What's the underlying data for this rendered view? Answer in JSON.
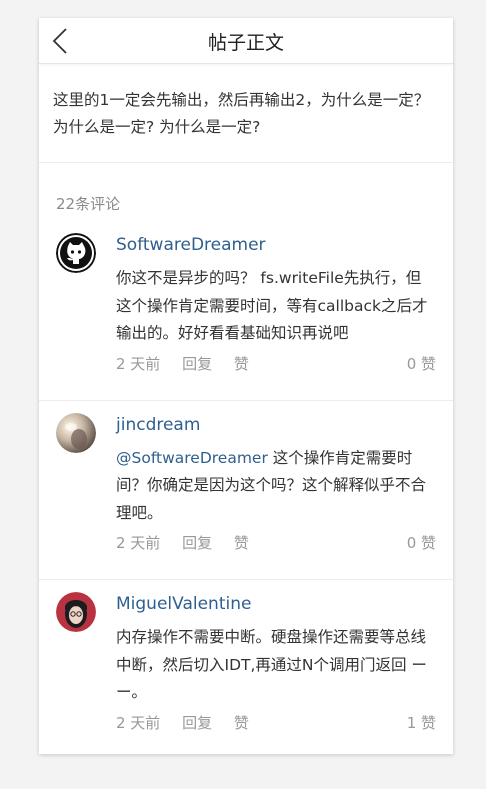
{
  "header": {
    "title": "帖子正文",
    "back_icon": "chevron-left-icon"
  },
  "post": {
    "content": "这里的1一定会先输出，然后再输出2，为什么是一定？ 为什么是一定? 为什么是一定?"
  },
  "comments_count": "22条评论",
  "comments": [
    {
      "author": "SoftwareDreamer",
      "avatar_icon": "github-octocat-icon",
      "mention": "",
      "text": "你这不是异步的吗？ fs.writeFile先执行，但这个操作肯定需要时间，等有callback之后才输出的。好好看看基础知识再说吧",
      "time": "2 天前",
      "reply": "回复",
      "like": "赞",
      "likes": "0 赞"
    },
    {
      "author": "jincdream",
      "avatar_icon": "user-photo-avatar",
      "mention": "@SoftwareDreamer",
      "text": " 这个操作肯定需要时间？你确定是因为这个吗？这个解释似乎不合理吧。",
      "time": "2 天前",
      "reply": "回复",
      "like": "赞",
      "likes": "0 赞"
    },
    {
      "author": "MiguelValentine",
      "avatar_icon": "user-photo-avatar",
      "mention": "",
      "text": "内存操作不需要中断。硬盘操作还需要等总线中断，然后切入IDT,再通过N个调用门返回 ー ー。",
      "time": "2 天前",
      "reply": "回复",
      "like": "赞",
      "likes": "1 赞"
    }
  ]
}
